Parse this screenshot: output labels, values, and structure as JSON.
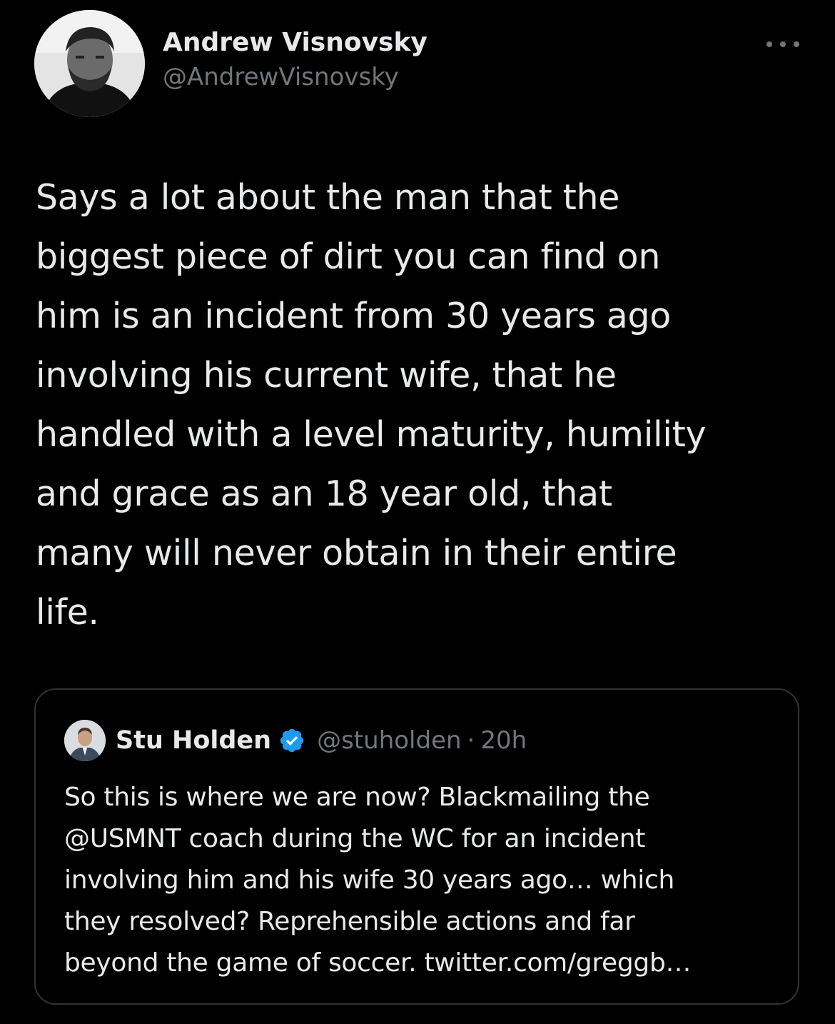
{
  "tweet": {
    "author": {
      "display_name": "Andrew Visnovsky",
      "handle": "@AndrewVisnovsky"
    },
    "more_icon": "more-horizontal-icon",
    "text_lines": [
      "Says a lot about the man that the",
      "biggest piece of dirt you can find on",
      "him is an incident from 30 years ago",
      "involving his current wife, that he",
      "handled with a level maturity, humility",
      "and grace as an 18 year old, that",
      "many will never obtain in their entire",
      "life."
    ]
  },
  "quoted_tweet": {
    "author": {
      "display_name": "Stu Holden",
      "verified_icon": "verified-badge-icon",
      "handle": "@stuholden",
      "separator": "·",
      "time": "20h"
    },
    "text_lines": [
      "So this is where we are now? Blackmailing the",
      "@USMNT coach during the WC for an incident",
      "involving him and his wife 30 years ago… which",
      "they resolved? Reprehensible actions and far",
      "beyond the game of soccer. twitter.com/greggb…"
    ]
  },
  "colors": {
    "background": "#000000",
    "primary_text": "#e7e9ea",
    "secondary_text": "#71767b",
    "border": "#2f3336",
    "verified_blue": "#1d9bf0"
  }
}
